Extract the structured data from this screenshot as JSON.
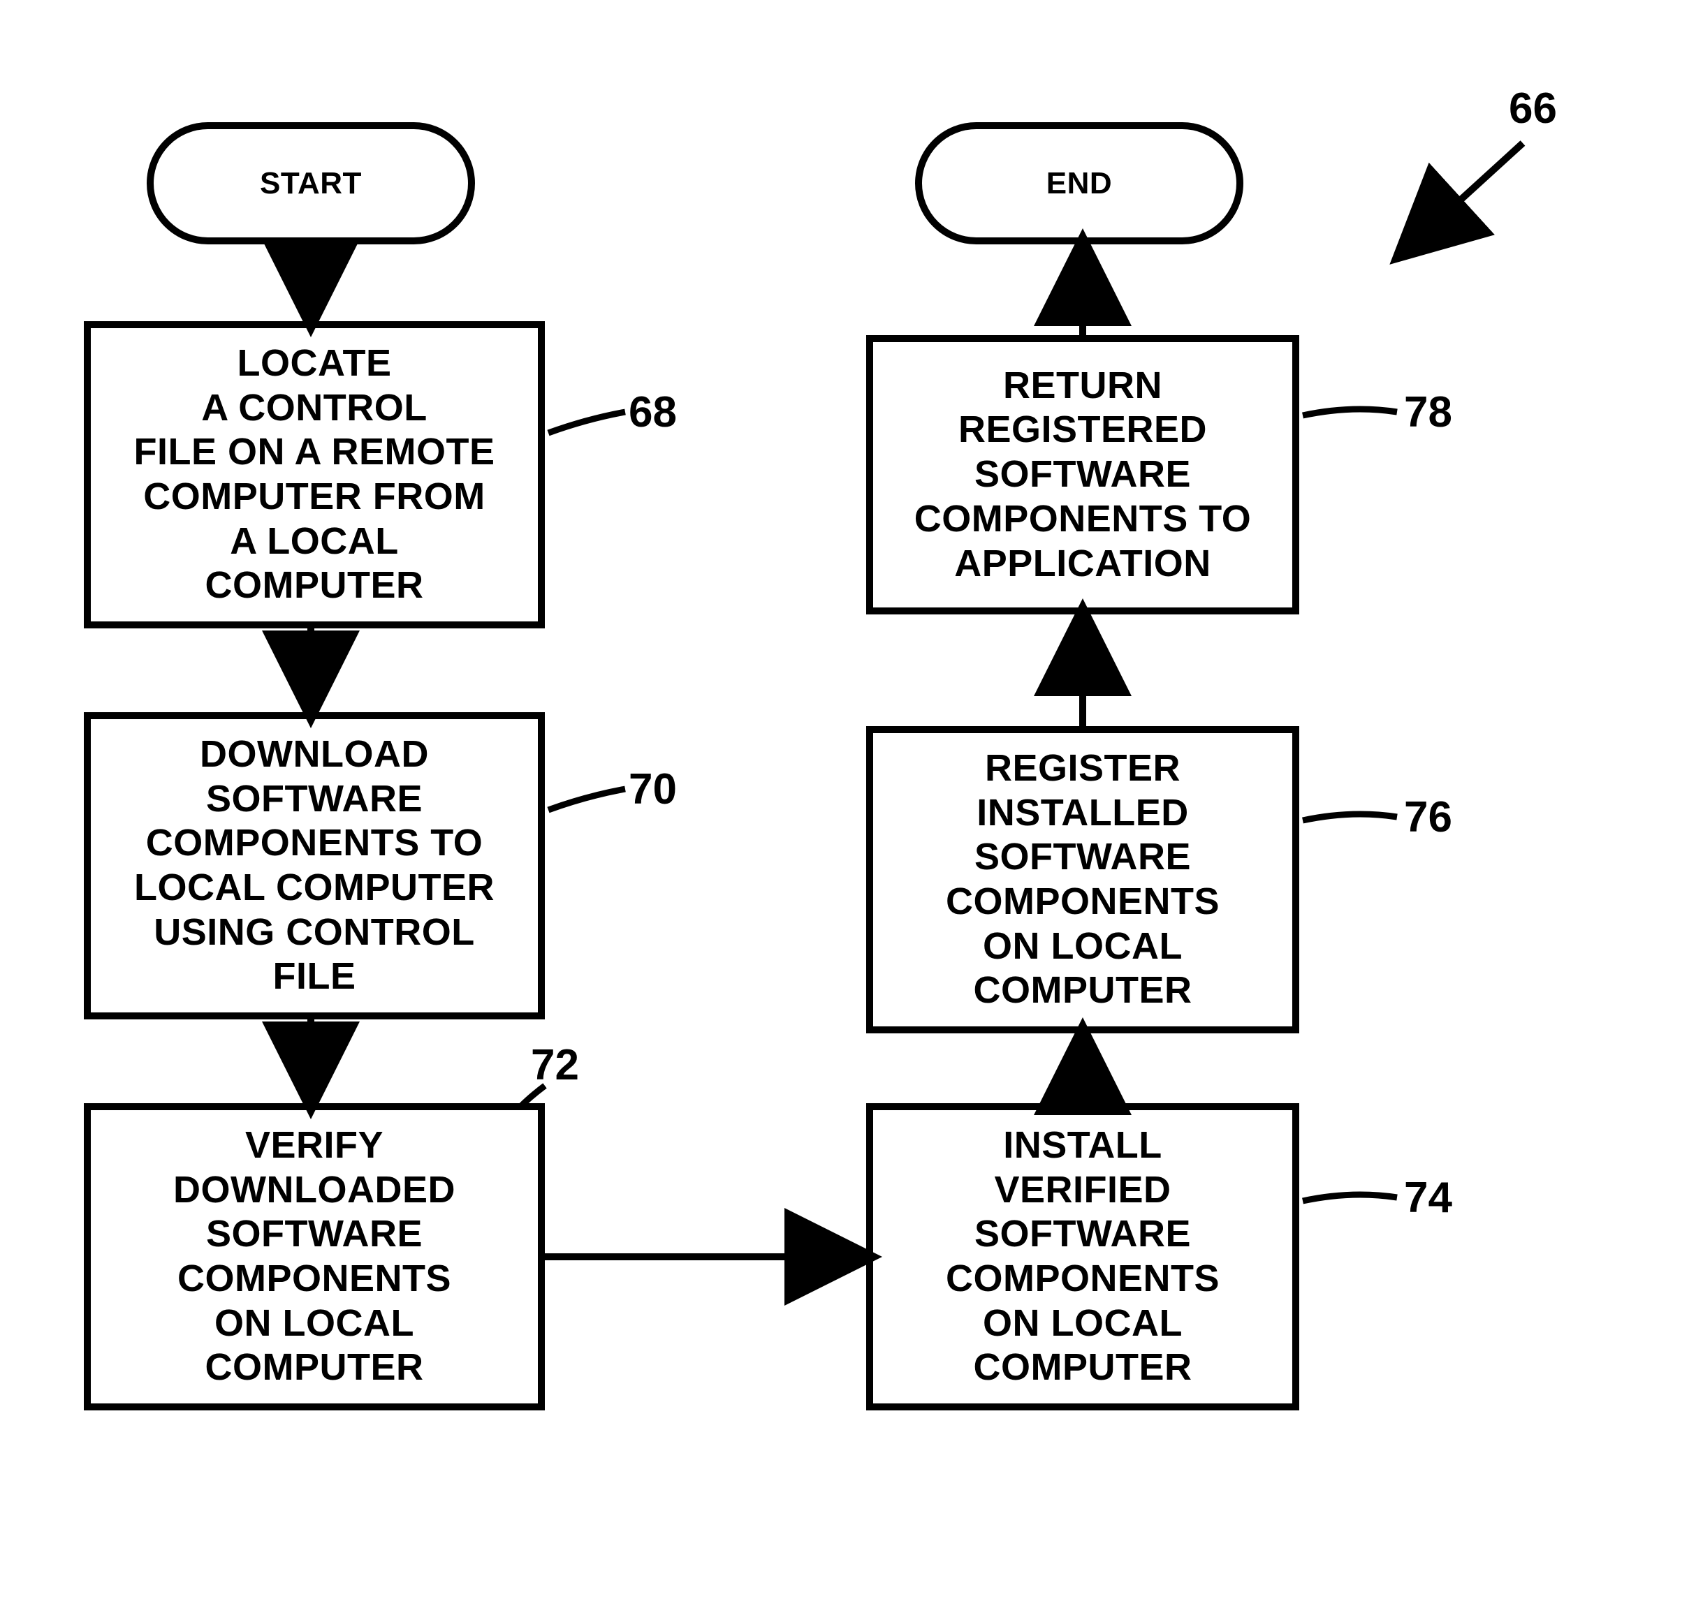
{
  "figure_ref": "66",
  "terminals": {
    "start": "START",
    "end": "END"
  },
  "steps": {
    "s68": {
      "text": "LOCATE\nA CONTROL\nFILE ON A REMOTE\nCOMPUTER FROM\nA LOCAL\nCOMPUTER",
      "ref": "68"
    },
    "s70": {
      "text": "DOWNLOAD\nSOFTWARE\nCOMPONENTS TO\nLOCAL COMPUTER\nUSING CONTROL\nFILE",
      "ref": "70"
    },
    "s72": {
      "text": "VERIFY\nDOWNLOADED\nSOFTWARE\nCOMPONENTS\nON LOCAL\nCOMPUTER",
      "ref": "72"
    },
    "s74": {
      "text": "INSTALL\nVERIFIED\nSOFTWARE\nCOMPONENTS\nON LOCAL\nCOMPUTER",
      "ref": "74"
    },
    "s76": {
      "text": "REGISTER\nINSTALLED\nSOFTWARE\nCOMPONENTS\nON LOCAL\nCOMPUTER",
      "ref": "76"
    },
    "s78": {
      "text": "RETURN\nREGISTERED\nSOFTWARE\nCOMPONENTS TO\nAPPLICATION",
      "ref": "78"
    }
  }
}
